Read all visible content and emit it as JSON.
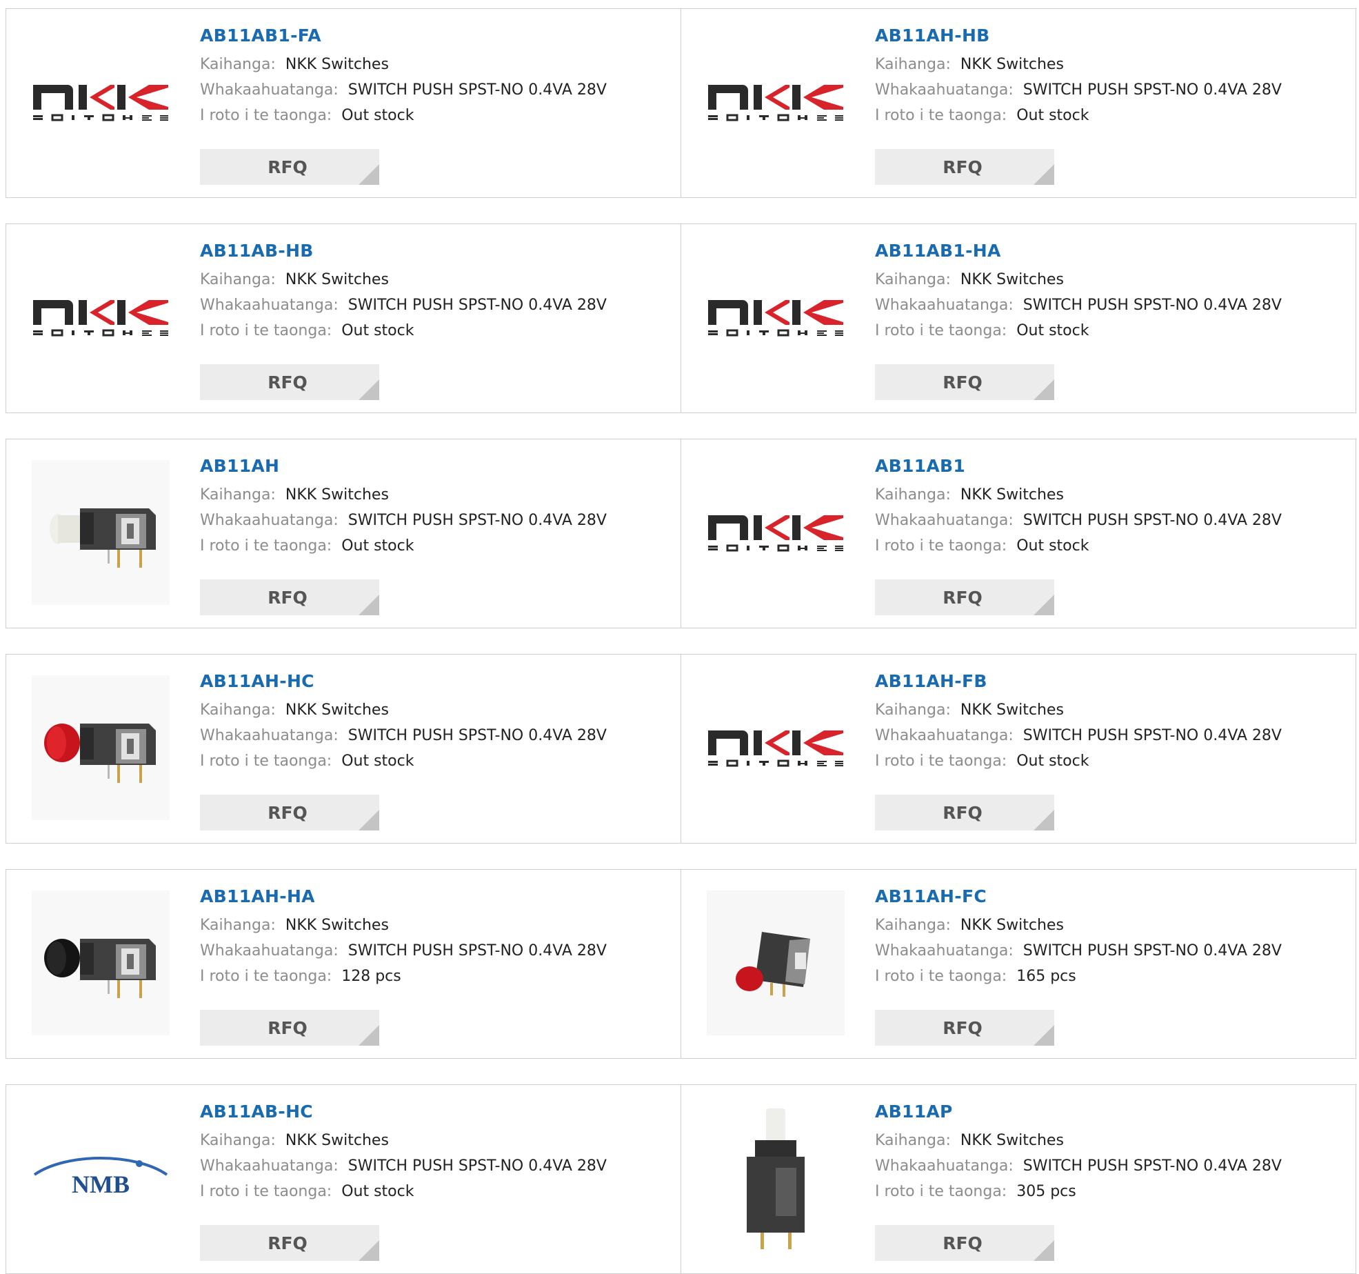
{
  "labels": {
    "manufacturer": "Kaihanga:",
    "description": "Whakaahuatanga:",
    "stock": "I roto i te taonga:",
    "rfq": "RFQ"
  },
  "colors": {
    "link": "#1a6aaf",
    "nkk_red": "#d8232a",
    "nkk_dark": "#2a2a2a",
    "nmb_blue": "#1f4f8f",
    "button_bg": "#ececec"
  },
  "products": [
    {
      "part": "AB11AB1-FA",
      "manufacturer": "NKK Switches",
      "description": "SWITCH PUSH SPST-NO 0.4VA 28V",
      "stock": "Out stock",
      "image": "nkk-logo"
    },
    {
      "part": "AB11AH-HB",
      "manufacturer": "NKK Switches",
      "description": "SWITCH PUSH SPST-NO 0.4VA 28V",
      "stock": "Out stock",
      "image": "nkk-logo"
    },
    {
      "part": "AB11AB-HB",
      "manufacturer": "NKK Switches",
      "description": "SWITCH PUSH SPST-NO 0.4VA 28V",
      "stock": "Out stock",
      "image": "nkk-logo"
    },
    {
      "part": "AB11AB1-HA",
      "manufacturer": "NKK Switches",
      "description": "SWITCH PUSH SPST-NO 0.4VA 28V",
      "stock": "Out stock",
      "image": "nkk-logo"
    },
    {
      "part": "AB11AH",
      "manufacturer": "NKK Switches",
      "description": "SWITCH PUSH SPST-NO 0.4VA 28V",
      "stock": "Out stock",
      "image": "switch-white"
    },
    {
      "part": "AB11AB1",
      "manufacturer": "NKK Switches",
      "description": "SWITCH PUSH SPST-NO 0.4VA 28V",
      "stock": "Out stock",
      "image": "nkk-logo"
    },
    {
      "part": "AB11AH-HC",
      "manufacturer": "NKK Switches",
      "description": "SWITCH PUSH SPST-NO 0.4VA 28V",
      "stock": "Out stock",
      "image": "switch-red-cap"
    },
    {
      "part": "AB11AH-FB",
      "manufacturer": "NKK Switches",
      "description": "SWITCH PUSH SPST-NO 0.4VA 28V",
      "stock": "Out stock",
      "image": "nkk-logo"
    },
    {
      "part": "AB11AH-HA",
      "manufacturer": "NKK Switches",
      "description": "SWITCH PUSH SPST-NO 0.4VA 28V",
      "stock": "128 pcs",
      "image": "switch-black-cap"
    },
    {
      "part": "AB11AH-FC",
      "manufacturer": "NKK Switches",
      "description": "SWITCH PUSH SPST-NO 0.4VA 28V",
      "stock": "165 pcs",
      "image": "switch-red-small"
    },
    {
      "part": "AB11AB-HC",
      "manufacturer": "NKK Switches",
      "description": "SWITCH PUSH SPST-NO 0.4VA 28V",
      "stock": "Out stock",
      "image": "nmb-logo",
      "logo_text": "NMB"
    },
    {
      "part": "AB11AP",
      "manufacturer": "NKK Switches",
      "description": "SWITCH PUSH SPST-NO 0.4VA 28V",
      "stock": "305 pcs",
      "image": "switch-vertical"
    }
  ]
}
